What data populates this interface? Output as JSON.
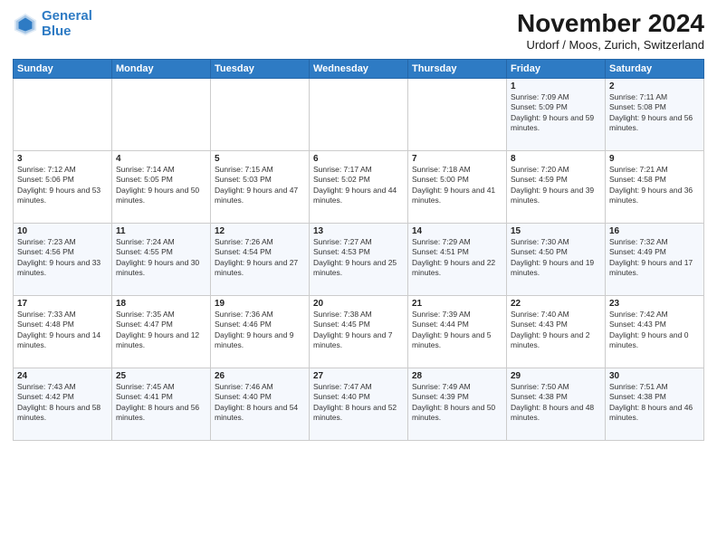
{
  "header": {
    "logo_line1": "General",
    "logo_line2": "Blue",
    "title": "November 2024",
    "subtitle": "Urdorf / Moos, Zurich, Switzerland"
  },
  "weekdays": [
    "Sunday",
    "Monday",
    "Tuesday",
    "Wednesday",
    "Thursday",
    "Friday",
    "Saturday"
  ],
  "weeks": [
    [
      {
        "day": "",
        "info": ""
      },
      {
        "day": "",
        "info": ""
      },
      {
        "day": "",
        "info": ""
      },
      {
        "day": "",
        "info": ""
      },
      {
        "day": "",
        "info": ""
      },
      {
        "day": "1",
        "info": "Sunrise: 7:09 AM\nSunset: 5:09 PM\nDaylight: 9 hours and 59 minutes."
      },
      {
        "day": "2",
        "info": "Sunrise: 7:11 AM\nSunset: 5:08 PM\nDaylight: 9 hours and 56 minutes."
      }
    ],
    [
      {
        "day": "3",
        "info": "Sunrise: 7:12 AM\nSunset: 5:06 PM\nDaylight: 9 hours and 53 minutes."
      },
      {
        "day": "4",
        "info": "Sunrise: 7:14 AM\nSunset: 5:05 PM\nDaylight: 9 hours and 50 minutes."
      },
      {
        "day": "5",
        "info": "Sunrise: 7:15 AM\nSunset: 5:03 PM\nDaylight: 9 hours and 47 minutes."
      },
      {
        "day": "6",
        "info": "Sunrise: 7:17 AM\nSunset: 5:02 PM\nDaylight: 9 hours and 44 minutes."
      },
      {
        "day": "7",
        "info": "Sunrise: 7:18 AM\nSunset: 5:00 PM\nDaylight: 9 hours and 41 minutes."
      },
      {
        "day": "8",
        "info": "Sunrise: 7:20 AM\nSunset: 4:59 PM\nDaylight: 9 hours and 39 minutes."
      },
      {
        "day": "9",
        "info": "Sunrise: 7:21 AM\nSunset: 4:58 PM\nDaylight: 9 hours and 36 minutes."
      }
    ],
    [
      {
        "day": "10",
        "info": "Sunrise: 7:23 AM\nSunset: 4:56 PM\nDaylight: 9 hours and 33 minutes."
      },
      {
        "day": "11",
        "info": "Sunrise: 7:24 AM\nSunset: 4:55 PM\nDaylight: 9 hours and 30 minutes."
      },
      {
        "day": "12",
        "info": "Sunrise: 7:26 AM\nSunset: 4:54 PM\nDaylight: 9 hours and 27 minutes."
      },
      {
        "day": "13",
        "info": "Sunrise: 7:27 AM\nSunset: 4:53 PM\nDaylight: 9 hours and 25 minutes."
      },
      {
        "day": "14",
        "info": "Sunrise: 7:29 AM\nSunset: 4:51 PM\nDaylight: 9 hours and 22 minutes."
      },
      {
        "day": "15",
        "info": "Sunrise: 7:30 AM\nSunset: 4:50 PM\nDaylight: 9 hours and 19 minutes."
      },
      {
        "day": "16",
        "info": "Sunrise: 7:32 AM\nSunset: 4:49 PM\nDaylight: 9 hours and 17 minutes."
      }
    ],
    [
      {
        "day": "17",
        "info": "Sunrise: 7:33 AM\nSunset: 4:48 PM\nDaylight: 9 hours and 14 minutes."
      },
      {
        "day": "18",
        "info": "Sunrise: 7:35 AM\nSunset: 4:47 PM\nDaylight: 9 hours and 12 minutes."
      },
      {
        "day": "19",
        "info": "Sunrise: 7:36 AM\nSunset: 4:46 PM\nDaylight: 9 hours and 9 minutes."
      },
      {
        "day": "20",
        "info": "Sunrise: 7:38 AM\nSunset: 4:45 PM\nDaylight: 9 hours and 7 minutes."
      },
      {
        "day": "21",
        "info": "Sunrise: 7:39 AM\nSunset: 4:44 PM\nDaylight: 9 hours and 5 minutes."
      },
      {
        "day": "22",
        "info": "Sunrise: 7:40 AM\nSunset: 4:43 PM\nDaylight: 9 hours and 2 minutes."
      },
      {
        "day": "23",
        "info": "Sunrise: 7:42 AM\nSunset: 4:43 PM\nDaylight: 9 hours and 0 minutes."
      }
    ],
    [
      {
        "day": "24",
        "info": "Sunrise: 7:43 AM\nSunset: 4:42 PM\nDaylight: 8 hours and 58 minutes."
      },
      {
        "day": "25",
        "info": "Sunrise: 7:45 AM\nSunset: 4:41 PM\nDaylight: 8 hours and 56 minutes."
      },
      {
        "day": "26",
        "info": "Sunrise: 7:46 AM\nSunset: 4:40 PM\nDaylight: 8 hours and 54 minutes."
      },
      {
        "day": "27",
        "info": "Sunrise: 7:47 AM\nSunset: 4:40 PM\nDaylight: 8 hours and 52 minutes."
      },
      {
        "day": "28",
        "info": "Sunrise: 7:49 AM\nSunset: 4:39 PM\nDaylight: 8 hours and 50 minutes."
      },
      {
        "day": "29",
        "info": "Sunrise: 7:50 AM\nSunset: 4:38 PM\nDaylight: 8 hours and 48 minutes."
      },
      {
        "day": "30",
        "info": "Sunrise: 7:51 AM\nSunset: 4:38 PM\nDaylight: 8 hours and 46 minutes."
      }
    ]
  ]
}
